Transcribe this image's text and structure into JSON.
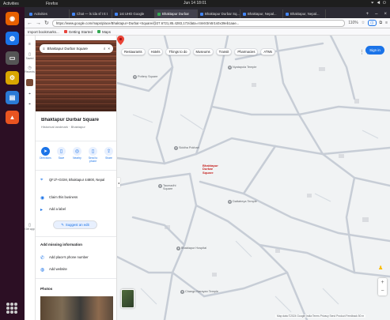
{
  "system": {
    "activities": "Activities",
    "app": "Firefox",
    "clock": "Jun 14 18:01",
    "tray": "⏷ ◀ ⏻"
  },
  "browser": {
    "tabs": [
      {
        "label": "Activities"
      },
      {
        "label": "Chat — ls /da sf t tt t"
      },
      {
        "label": "1st UHD Google"
      },
      {
        "label": "Bhaktapur Durbar"
      },
      {
        "label": "Bhaktapur Durbar Sq..."
      },
      {
        "label": "Bhaktapur, Nepal..."
      },
      {
        "label": "Bhaktapur, Nepal..."
      }
    ],
    "url": "https://www.google.com/maps/place/Bhaktapur+Durbar+Square/@27.6721,85.4283,17z/data=!4m6!3m5!1s0x39eb1aae...",
    "bookmarks": [
      {
        "label": "Import bookmarks..."
      },
      {
        "label": "Getting Started"
      },
      {
        "label": "Maps"
      }
    ],
    "zoom": "110%"
  },
  "panel": {
    "search_query": "Bhaktapur Durbar Square",
    "place_name": "Bhaktapur Durbar Square",
    "place_sub": "Historical landmark · Bhaktapur",
    "actions": [
      {
        "label": "Directions",
        "icon": "directions-icon"
      },
      {
        "label": "Save",
        "icon": "save-icon"
      },
      {
        "label": "Nearby",
        "icon": "nearby-icon"
      },
      {
        "label": "Send to phone",
        "icon": "phone-icon"
      },
      {
        "label": "Share",
        "icon": "share-icon"
      }
    ],
    "info": [
      {
        "icon": "location-icon",
        "text": "QFJ7+GGM, Bhaktapur 44800, Nepal"
      },
      {
        "icon": "plus-code-icon",
        "text": "Claim this business"
      },
      {
        "icon": "label-icon",
        "text": "Add a label"
      }
    ],
    "suggest_label": "Suggest an edit",
    "add_missing": "Add missing information",
    "extra": [
      {
        "icon": "phone-icon",
        "text": "Add place's phone number"
      },
      {
        "icon": "globe-icon",
        "text": "Add website"
      }
    ],
    "photos_heading": "Photos"
  },
  "rail": {
    "menu": "Menu",
    "saved": "Saved",
    "recents": "Recents",
    "get_app": "Get app"
  },
  "map": {
    "chips": [
      {
        "label": "Restaurants"
      },
      {
        "label": "Hotels"
      },
      {
        "label": "Things to do"
      },
      {
        "label": "Museums"
      },
      {
        "label": "Transit"
      },
      {
        "label": "Pharmacies"
      },
      {
        "label": "ATMs"
      }
    ],
    "signin": "Sign in",
    "pin_label": [
      "Bhaktapur",
      "Durbar",
      "Square"
    ],
    "pois": [
      {
        "label": "Pottery Square",
        "color": "#8e9297"
      },
      {
        "label": "Nyatapola Temple",
        "color": "#8e9297"
      },
      {
        "label": "Siddha Pokhari",
        "color": "#8e9297"
      },
      {
        "label": "Taumadhi Square",
        "color": "#8e9297"
      },
      {
        "label": "Dattatreya Temple",
        "color": "#8e9297"
      },
      {
        "label": "Bhaktapur Hospital",
        "color": "#8e9297"
      },
      {
        "label": "Changu Narayan Temple",
        "color": "#8e9297"
      }
    ],
    "attribution": "Map data ©2024 Google  India  Terms  Privacy  Send Product Feedback  50 m",
    "layers_label": "Layers"
  },
  "colors": {
    "accent": "#1a73e8",
    "pin": "#ea4335",
    "dock": "#2c0f24"
  }
}
